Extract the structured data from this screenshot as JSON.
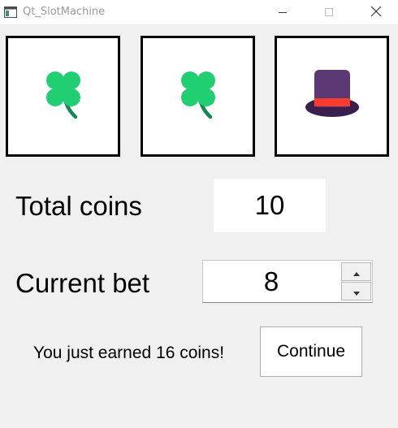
{
  "window": {
    "title": "Qt_SlotMachine",
    "icons": {
      "app": "app-window-icon",
      "minimize": "minimize-icon",
      "maximize": "maximize-icon",
      "close": "close-icon"
    }
  },
  "reels": [
    {
      "symbol": "four-leaf-clover",
      "icon": "clover-icon"
    },
    {
      "symbol": "four-leaf-clover",
      "icon": "clover-icon"
    },
    {
      "symbol": "top-hat",
      "icon": "top-hat-icon"
    }
  ],
  "stats": {
    "total_coins_label": "Total coins",
    "total_coins_value": "10",
    "current_bet_label": "Current bet",
    "current_bet_value": "8"
  },
  "result": {
    "message": "You just earned 16 coins!",
    "continue_label": "Continue"
  },
  "colors": {
    "clover_green": "#1fcf72",
    "clover_stem": "#0e8a52",
    "hat_purple": "#5b3a73",
    "hat_brim": "#3b1f4d",
    "hat_band": "#ff3b30"
  }
}
